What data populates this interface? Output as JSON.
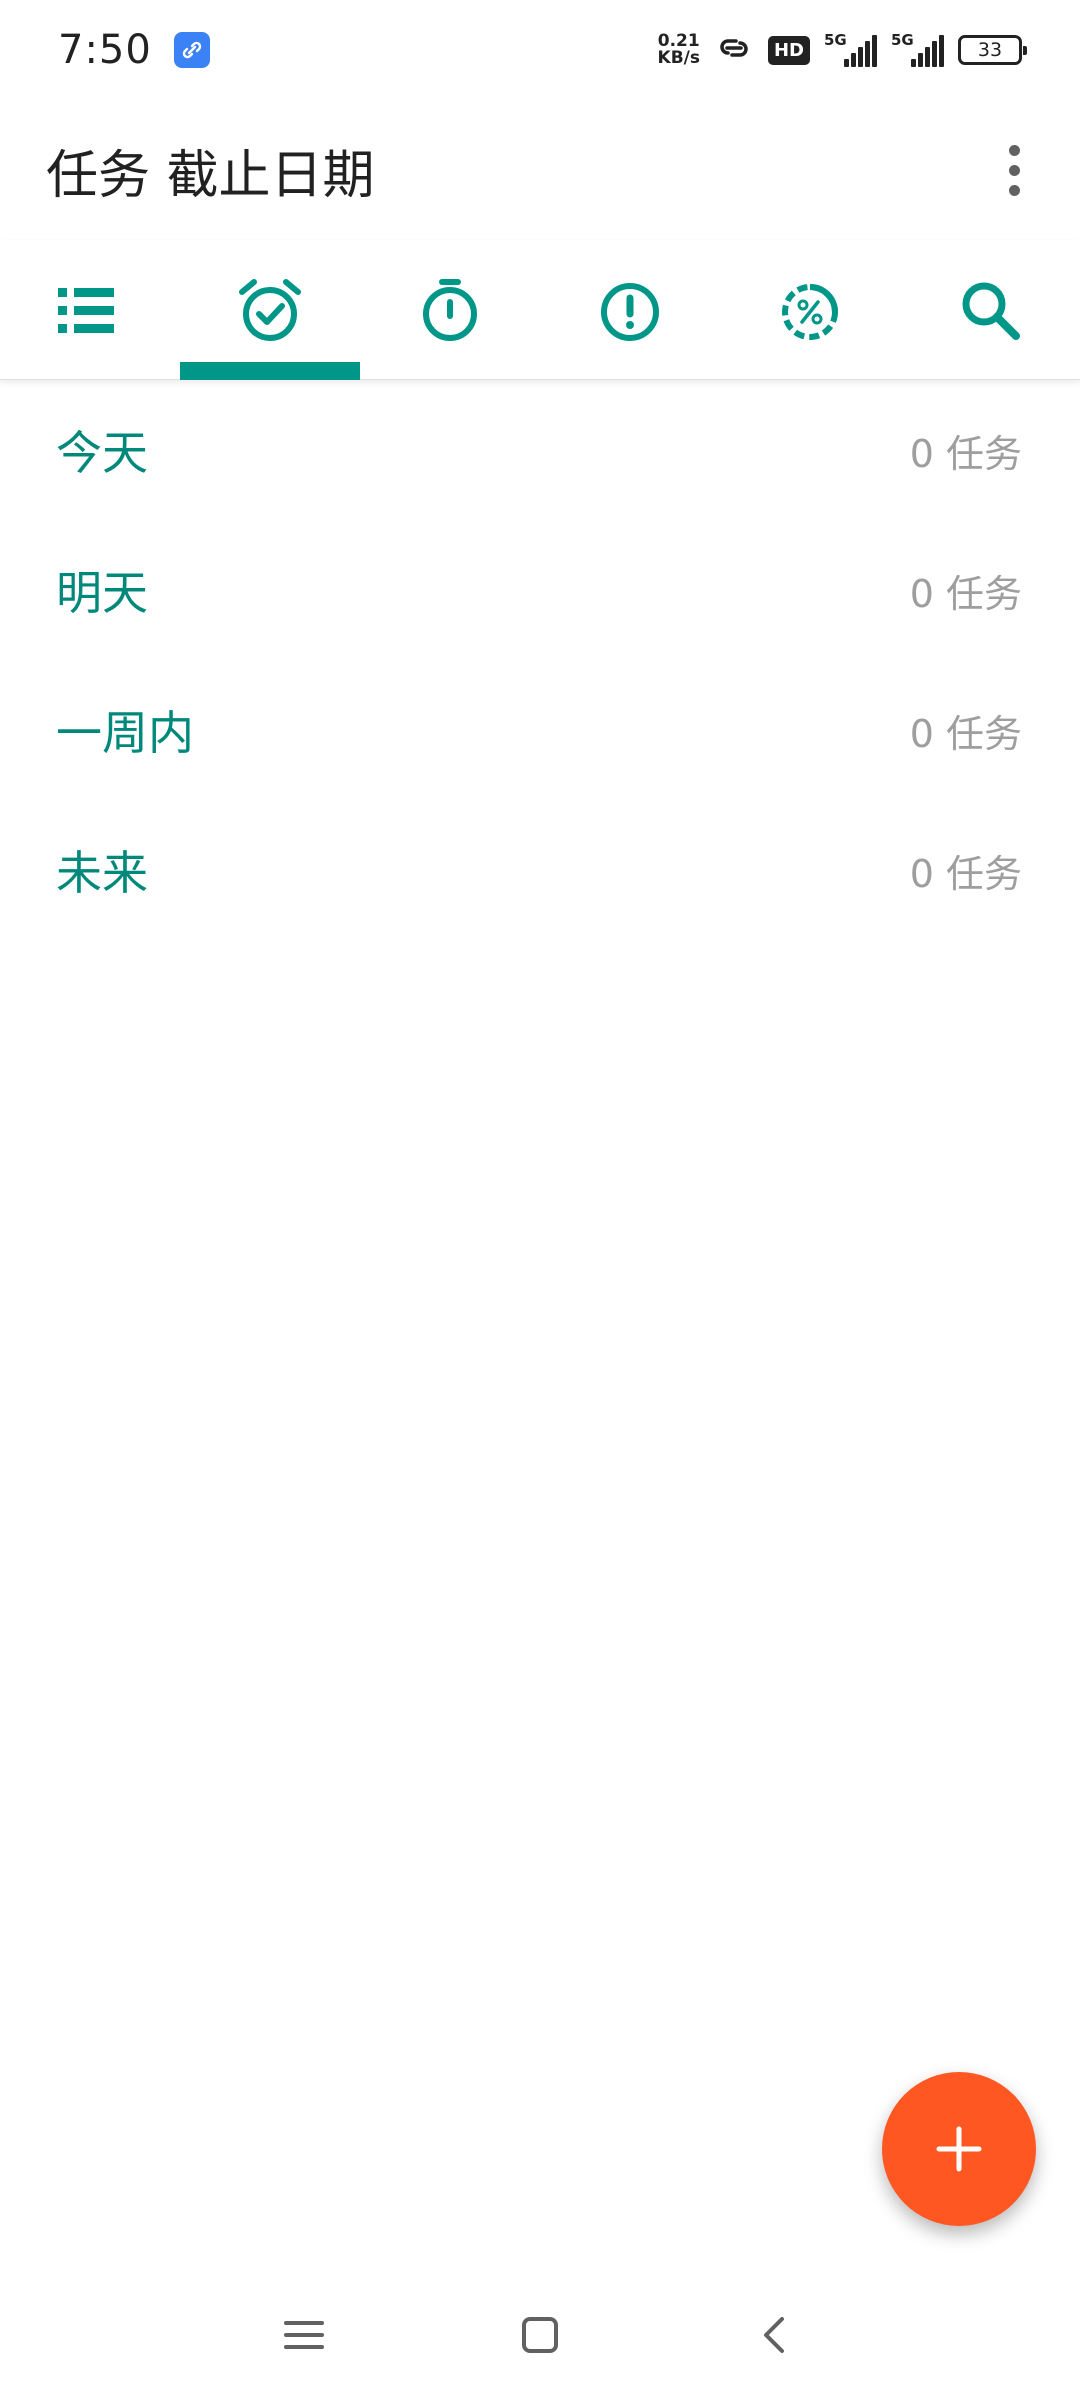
{
  "status_bar": {
    "time": "7:50",
    "net_speed_value": "0.21",
    "net_speed_unit": "KB/s",
    "hd_label": "HD",
    "signal1_label": "5G",
    "signal2_label": "5G",
    "battery_level": "33"
  },
  "app_bar": {
    "title": "任务 截止日期",
    "overflow_icon": "more-vert-icon"
  },
  "tabs": [
    {
      "icon": "list-icon",
      "selected": false
    },
    {
      "icon": "alarm-check-icon",
      "selected": true
    },
    {
      "icon": "stopwatch-icon",
      "selected": false
    },
    {
      "icon": "priority-icon",
      "selected": false
    },
    {
      "icon": "progress-percent-icon",
      "selected": false
    },
    {
      "icon": "search-icon",
      "selected": false
    }
  ],
  "deadline_groups": [
    {
      "label": "今天",
      "count": "0 任务"
    },
    {
      "label": "明天",
      "count": "0 任务"
    },
    {
      "label": "一周内",
      "count": "0 任务"
    },
    {
      "label": "未来",
      "count": "0 任务"
    }
  ],
  "fab": {
    "icon": "add-icon"
  },
  "nav_bar": {
    "icons": [
      "menu-icon",
      "home-icon",
      "back-icon"
    ]
  },
  "colors": {
    "accent": "#009688",
    "list_text": "#00897b",
    "fab": "#ff5722",
    "count_text": "#9e9e9e"
  }
}
